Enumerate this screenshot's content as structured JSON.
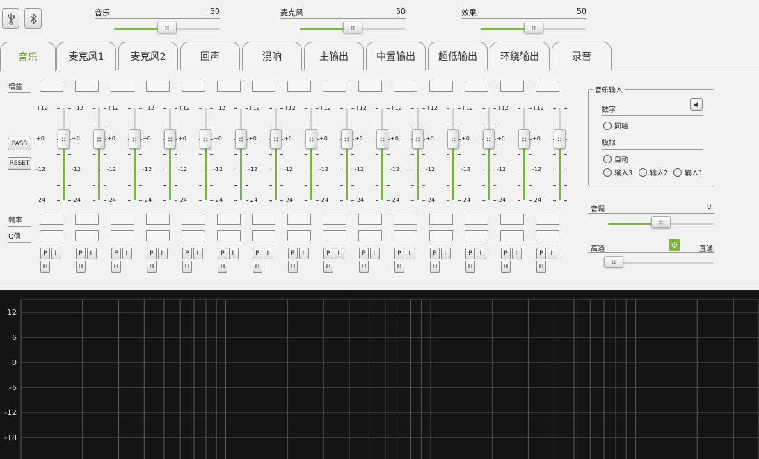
{
  "top": {
    "usb_icon": "usb-icon",
    "bluetooth_icon": "bluetooth-icon",
    "sliders": [
      {
        "label": "音乐",
        "value": "50",
        "fraction": 0.5
      },
      {
        "label": "麦克风",
        "value": "50",
        "fraction": 0.5
      },
      {
        "label": "效果",
        "value": "50",
        "fraction": 0.5
      }
    ]
  },
  "tabs": [
    "音乐",
    "麦克风1",
    "麦克风2",
    "回声",
    "混响",
    "主输出",
    "中置输出",
    "超低输出",
    "环绕输出",
    "录音"
  ],
  "eq": {
    "gain_label": "增益",
    "freq_label": "频率",
    "q_label": "Q值",
    "pass_label": "PASS",
    "reset_label": "RESET",
    "scale": [
      "+12",
      "+0",
      "-12",
      "-24"
    ],
    "band_count": 15,
    "band_values_db": [
      0,
      0,
      0,
      0,
      0,
      0,
      0,
      0,
      0,
      0,
      0,
      0,
      0,
      0,
      0
    ],
    "filter_buttons": {
      "p": "P",
      "l": "L",
      "h": "H"
    }
  },
  "music_input": {
    "legend": "音乐输入",
    "digital_label": "数字",
    "coax_label": "同轴",
    "analog_label": "模拟",
    "auto_label": "自动",
    "inputs": [
      "输入3",
      "输入2",
      "输入1"
    ]
  },
  "tone": {
    "label": "音调",
    "value": "0",
    "fraction": 0.5
  },
  "crossover": {
    "left_label": "高通",
    "right_label": "直通",
    "fraction": 0.0
  },
  "graph": {
    "y_ticks": [
      "12",
      "6",
      "0",
      "-6",
      "-12",
      "-18"
    ],
    "colors": {
      "background": "#141414",
      "grid": "#5a5a5a",
      "accent": "#7cb342"
    }
  }
}
